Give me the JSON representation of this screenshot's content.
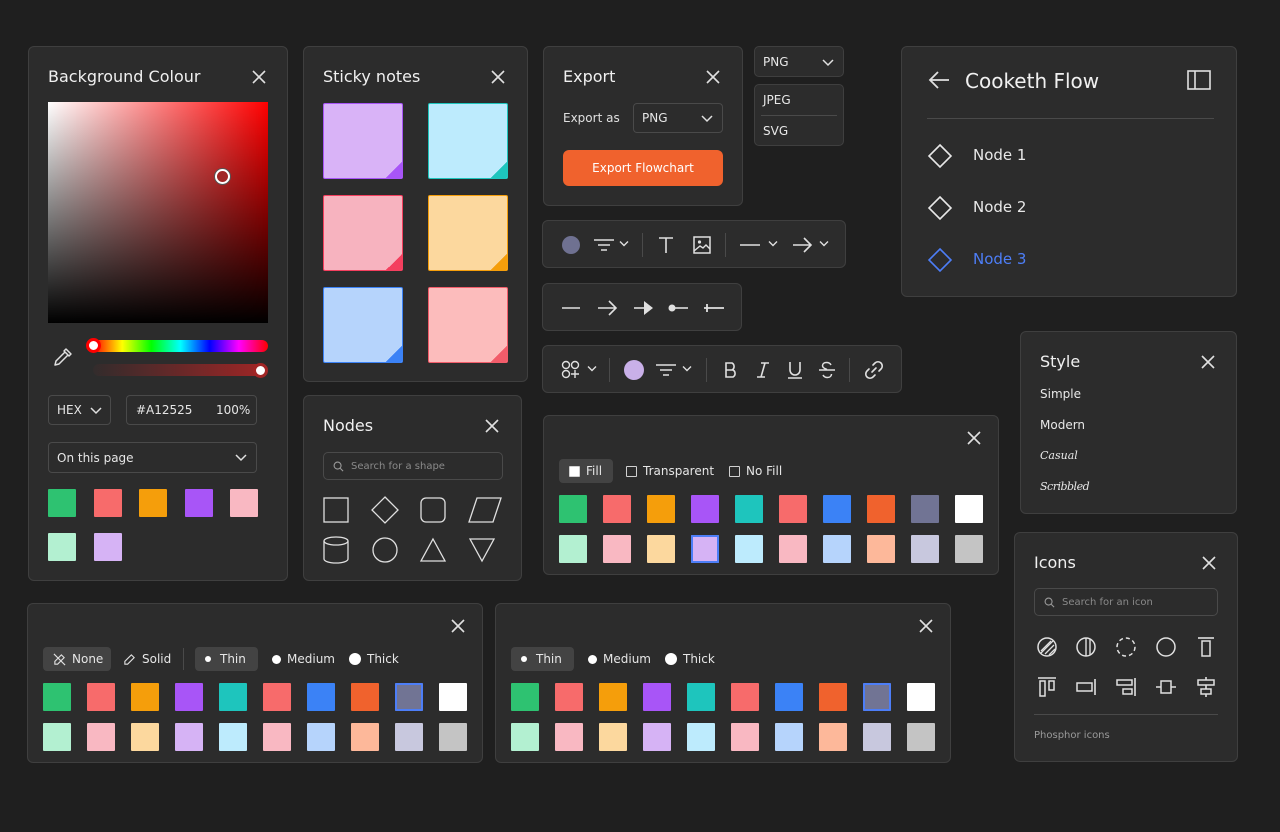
{
  "background_colour": {
    "title": "Background Colour",
    "format": "HEX",
    "hex_value": "#A12525",
    "opacity": "100%",
    "scope": "On this page",
    "selected_color": "#A12525",
    "swatches": [
      "#2ec271",
      "#f76b6b",
      "#f59e0b",
      "#a855f7",
      "#f9b8c2",
      "#b3f0d1",
      "#d6b3f5"
    ]
  },
  "sticky_notes": {
    "title": "Sticky notes",
    "notes": [
      {
        "color": "#d9b3f7",
        "corner": "#a855f7"
      },
      {
        "color": "#bdebfd",
        "corner": "#1ec5bd"
      },
      {
        "color": "#f7b3bf",
        "corner": "#f43f5e"
      },
      {
        "color": "#fcd89e",
        "corner": "#f59e0b"
      },
      {
        "color": "#b6d4fc",
        "corner": "#3b82f6"
      },
      {
        "color": "#fcbcbc",
        "corner": "#f25c6a"
      }
    ]
  },
  "nodes": {
    "title": "Nodes",
    "search_placeholder": "Search for a shape",
    "shapes": [
      "square-icon",
      "diamond-icon",
      "rounded-square-icon",
      "parallelogram-icon",
      "cylinder-icon",
      "circle-icon",
      "triangle-icon",
      "inverted-triangle-icon"
    ]
  },
  "export": {
    "title": "Export",
    "export_as_label": "Export as",
    "format": "PNG",
    "button_label": "Export Flowchart",
    "dropdown_selected": "PNG",
    "dropdown_options": [
      "JPEG",
      "SVG"
    ]
  },
  "flow": {
    "title": "Cooketh Flow",
    "nodes": [
      {
        "label": "Node 1",
        "active": false
      },
      {
        "label": "Node 2",
        "active": false
      },
      {
        "label": "Node 3",
        "active": true
      }
    ]
  },
  "toolbar1": {
    "color_dot": "#6f7191"
  },
  "toolbar3": {
    "color_dot": "#c9b0e8"
  },
  "fill_panel": {
    "options": [
      "Fill",
      "Transparent",
      "No Fill"
    ],
    "selected_index": 4,
    "row1": [
      "#2ec271",
      "#f76b6b",
      "#f59e0b",
      "#a855f7",
      "#1ec5bd",
      "#f76b6b",
      "#3b82f6",
      "#f0622d",
      "#717494",
      "#ffffff"
    ],
    "row2": [
      "#b3f0d1",
      "#f9b8c2",
      "#fcd89e",
      "#d6b3f5",
      "#bdebfd",
      "#f9b8c2",
      "#b6d4fc",
      "#fdb89a",
      "#c8c8de",
      "#c4c4c4"
    ]
  },
  "style": {
    "title": "Style",
    "options": [
      "Simple",
      "Modern",
      "Casual",
      "Scribbled"
    ]
  },
  "icons": {
    "title": "Icons",
    "search_placeholder": "Search for an icon",
    "footer": "Phosphor icons"
  },
  "stroke_panel": {
    "style_options": [
      "None",
      "Solid"
    ],
    "weights": [
      "Thin",
      "Medium",
      "Thick"
    ],
    "row1": [
      "#2ec271",
      "#f76b6b",
      "#f59e0b",
      "#a855f7",
      "#1ec5bd",
      "#f76b6b",
      "#3b82f6",
      "#f0622d",
      "#717494",
      "#ffffff"
    ],
    "row2": [
      "#b3f0d1",
      "#f9b8c2",
      "#fcd89e",
      "#d6b3f5",
      "#bdebfd",
      "#f9b8c2",
      "#b6d4fc",
      "#fdb89a",
      "#c8c8de",
      "#c4c4c4"
    ]
  },
  "weight_panel": {
    "weights": [
      "Thin",
      "Medium",
      "Thick"
    ]
  },
  "colors": {
    "accent": "#f0622d",
    "highlight": "#4d7ef7",
    "panel": "#2c2c2c"
  }
}
